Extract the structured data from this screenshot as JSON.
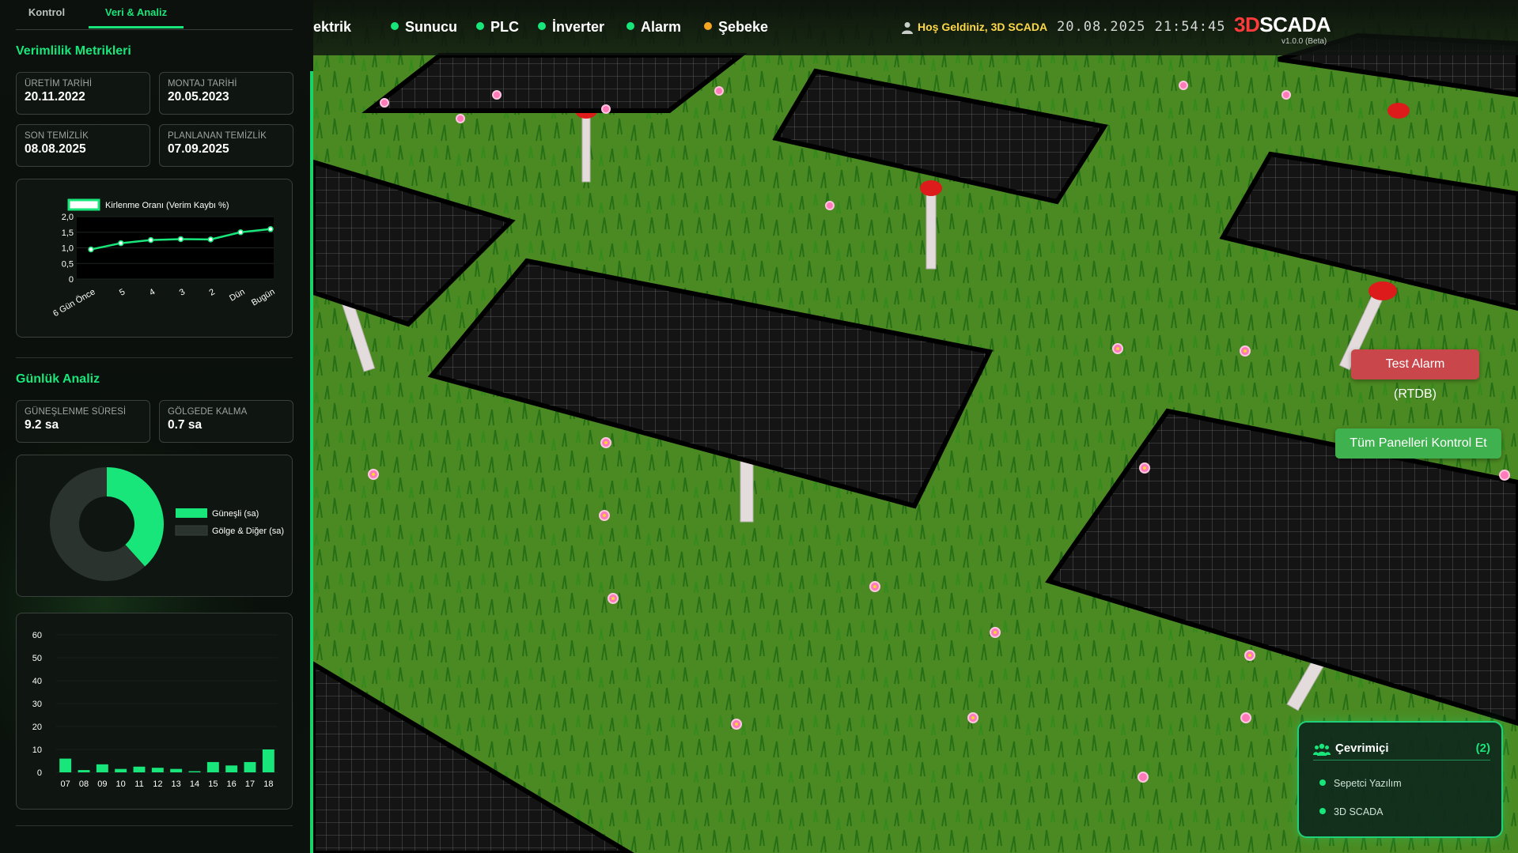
{
  "tabs": [
    {
      "label": "Kontrol",
      "active": false
    },
    {
      "label": "Veri & Analiz",
      "active": true
    }
  ],
  "efficiency": {
    "title": "Verimlilik Metrikleri",
    "metrics": [
      {
        "label": "ÜRETİM TARİHİ",
        "value": "20.11.2022"
      },
      {
        "label": "MONTAJ TARİHİ",
        "value": "20.05.2023"
      },
      {
        "label": "SON TEMİZLİK",
        "value": "08.08.2025"
      },
      {
        "label": "PLANLANAN TEMİZLİK",
        "value": "07.09.2025"
      }
    ]
  },
  "daily": {
    "title": "Günlük Analiz",
    "metrics": [
      {
        "label": "GÜNEŞLENME SÜRESİ",
        "value": "9.2 sa"
      },
      {
        "label": "GÖLGEDE KALMA",
        "value": "0.7 sa"
      }
    ]
  },
  "chart_data": [
    {
      "type": "line",
      "legend": "Kirlenme Oranı (Verim Kaybı %)",
      "x": [
        "6 Gün Önce",
        "5",
        "4",
        "3",
        "2",
        "Dün",
        "Bugün"
      ],
      "series": [
        {
          "name": "Kirlenme Oranı (Verim Kaybı %)",
          "values": [
            0.95,
            1.15,
            1.25,
            1.28,
            1.27,
            1.5,
            1.6
          ]
        }
      ],
      "ylim": [
        0,
        2.0
      ],
      "yticks": [
        "2,0",
        "1,5",
        "1,0",
        "0,5",
        "0"
      ],
      "color": "#19e67a"
    },
    {
      "type": "pie",
      "labels": [
        "Güneşli (sa)",
        "Gölge & Diğer (sa)"
      ],
      "values": [
        9.2,
        14.8
      ],
      "colors": [
        "#19e67a",
        "#2a332d"
      ]
    },
    {
      "type": "bar",
      "categories": [
        "07",
        "08",
        "09",
        "10",
        "11",
        "12",
        "13",
        "14",
        "15",
        "16",
        "17",
        "18"
      ],
      "values": [
        6,
        1,
        3.5,
        1.5,
        2.5,
        2,
        1.5,
        0.5,
        4.5,
        3,
        4.5,
        10
      ],
      "ylim": [
        0,
        60
      ],
      "yticks": [
        "60",
        "50",
        "40",
        "30",
        "20",
        "10",
        "0"
      ],
      "color": "#19e67a"
    }
  ],
  "topbar": {
    "items": [
      {
        "label": "ektrik",
        "dot": null
      },
      {
        "label": "Sunucu",
        "dot": "#19e67a"
      },
      {
        "label": "PLC",
        "dot": "#19e67a"
      },
      {
        "label": "İnverter",
        "dot": "#19e67a"
      },
      {
        "label": "Alarm",
        "dot": "#19e67a"
      },
      {
        "label": "Şebeke",
        "dot": "#f5a623"
      }
    ],
    "welcome": "Hoş Geldiniz, 3D SCADA",
    "datetime": "20.08.2025 21:54:45",
    "brand_accent": "3D",
    "brand_main": "SCADA",
    "version": "v1.0.0 (Beta)"
  },
  "buttons": {
    "test_alarm": "Test Alarm (RTDB)",
    "check_panels": "Tüm Panelleri Kontrol Et"
  },
  "online": {
    "title": "Çevrimiçi",
    "count": "(2)",
    "users": [
      "Sepetci Yazılım",
      "3D SCADA"
    ]
  }
}
